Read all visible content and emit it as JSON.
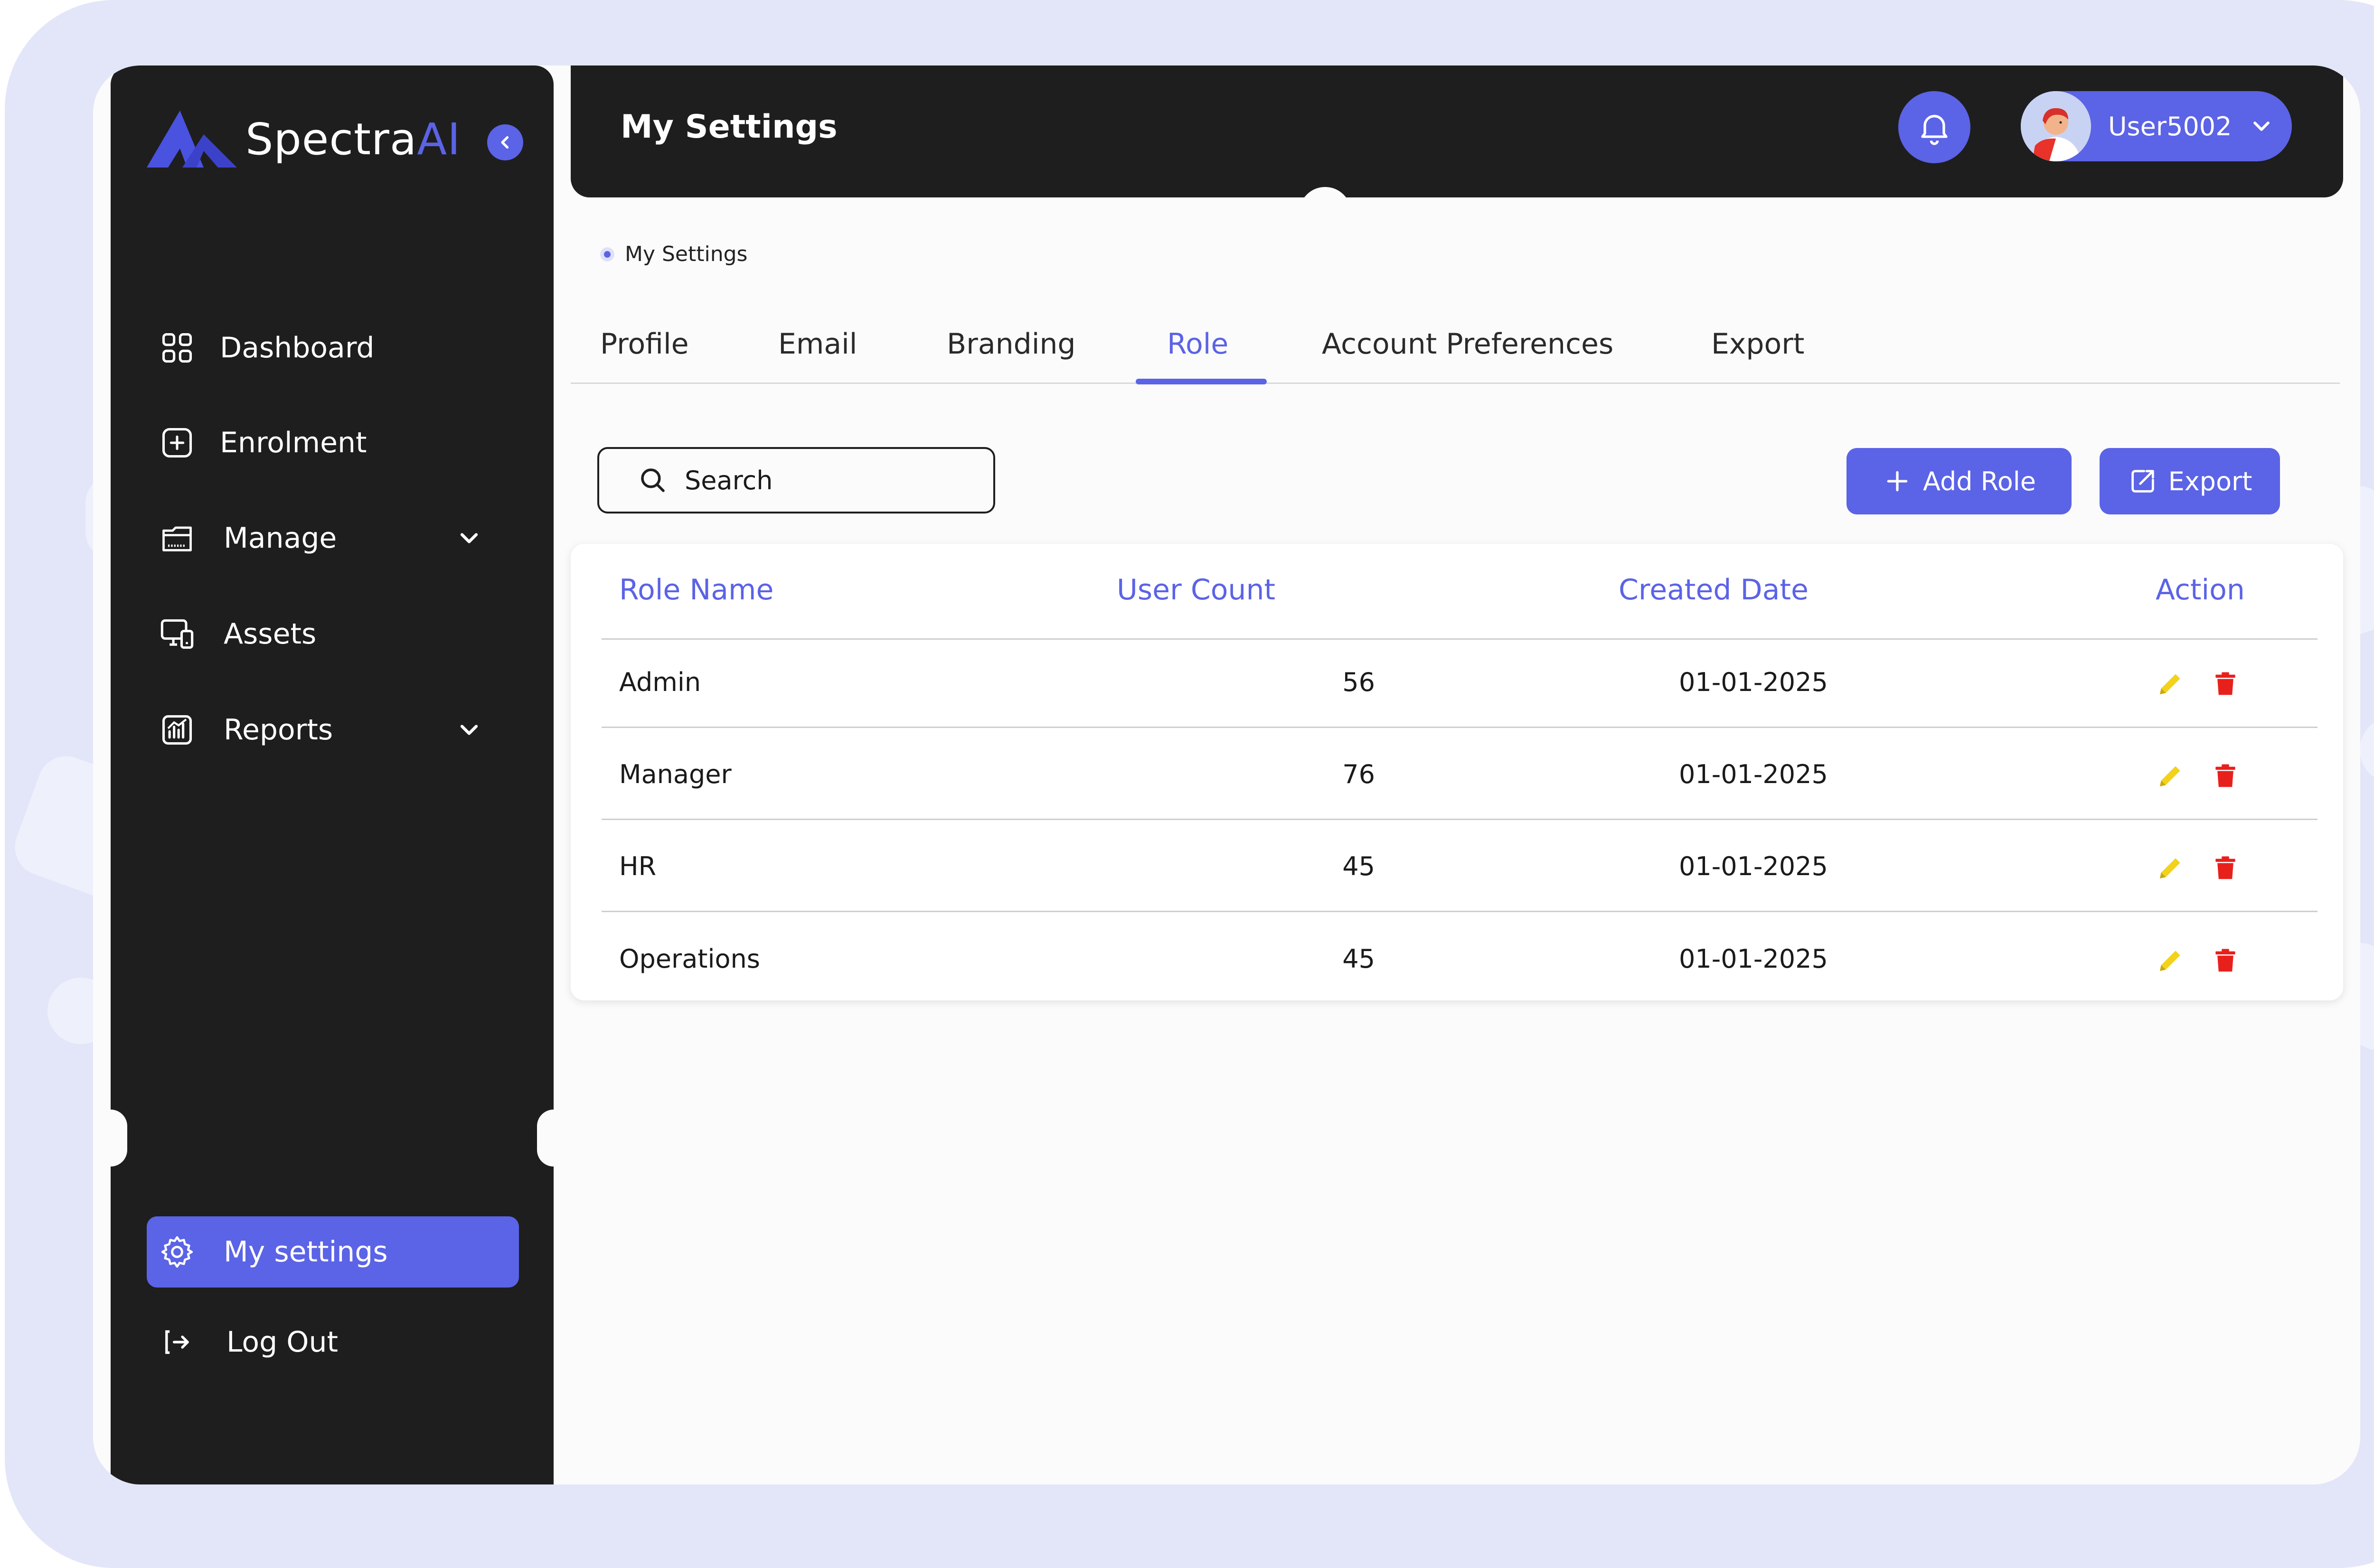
{
  "brand": {
    "name_main": "Spectra",
    "name_accent": "AI",
    "accent_color": "#5b63e6"
  },
  "sidebar": {
    "items": [
      {
        "label": "Dashboard",
        "icon": "grid-icon"
      },
      {
        "label": "Enrolment",
        "icon": "plus-square-icon"
      },
      {
        "label": "Manage",
        "icon": "folder-icon",
        "has_submenu": true
      },
      {
        "label": "Assets",
        "icon": "monitor-device-icon"
      },
      {
        "label": "Reports",
        "icon": "chart-icon",
        "has_submenu": true
      }
    ],
    "settings_label": "My settings",
    "logout_label": "Log Out"
  },
  "header": {
    "title": "My Settings",
    "user_name": "User5002"
  },
  "breadcrumb": {
    "current": "My Settings"
  },
  "tabs": [
    "Profile",
    "Email",
    "Branding",
    "Role",
    "Account Preferences",
    "Export"
  ],
  "active_tab": "Role",
  "toolbar": {
    "search_placeholder": "Search",
    "add_label": "Add Role",
    "export_label": "Export"
  },
  "table": {
    "headers": [
      "Role Name",
      "User Count",
      "Created Date",
      "Action"
    ],
    "rows": [
      {
        "role": "Admin",
        "count": "56",
        "date": "01-01-2025"
      },
      {
        "role": "Manager",
        "count": "76",
        "date": "01-01-2025"
      },
      {
        "role": "HR",
        "count": "45",
        "date": "01-01-2025"
      },
      {
        "role": "Operations",
        "count": "45",
        "date": "01-01-2025"
      }
    ],
    "edit_color": "#f2d21b",
    "delete_color": "#e8201c"
  }
}
